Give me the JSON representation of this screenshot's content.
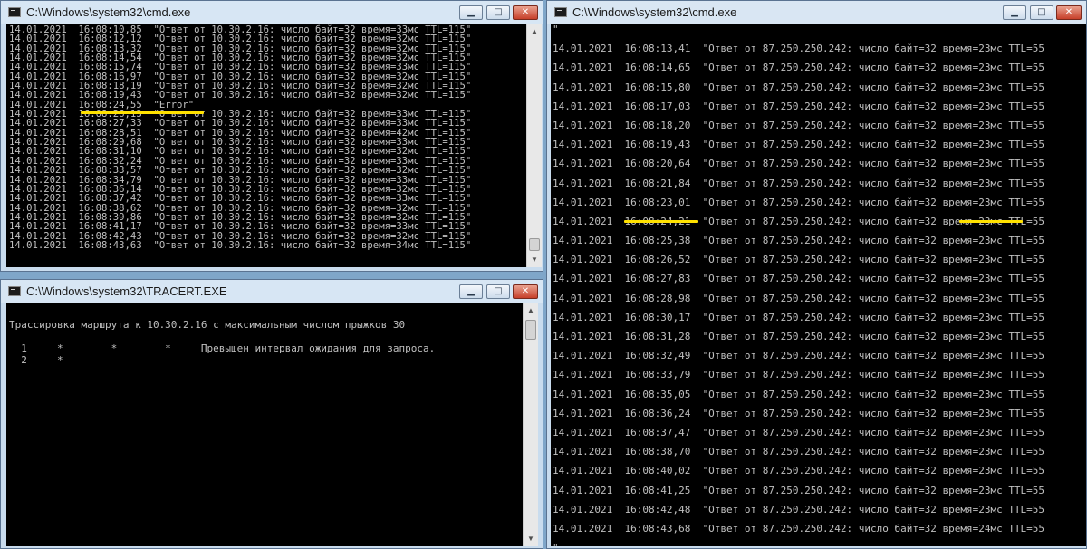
{
  "window1": {
    "title": "C:\\Windows\\system32\\cmd.exe",
    "lines": [
      "14.01.2021  16:08:10,85  \"Ответ от 10.30.2.16: число байт=32 время=33мс TTL=115\"",
      "14.01.2021  16:08:12,12  \"Ответ от 10.30.2.16: число байт=32 время=32мс TTL=115\"",
      "14.01.2021  16:08:13,32  \"Ответ от 10.30.2.16: число байт=32 время=32мс TTL=115\"",
      "14.01.2021  16:08:14,54  \"Ответ от 10.30.2.16: число байт=32 время=32мс TTL=115\"",
      "14.01.2021  16:08:15,74  \"Ответ от 10.30.2.16: число байт=32 время=33мс TTL=115\"",
      "14.01.2021  16:08:16,97  \"Ответ от 10.30.2.16: число байт=32 время=32мс TTL=115\"",
      "14.01.2021  16:08:18,19  \"Ответ от 10.30.2.16: число байт=32 время=32мс TTL=115\"",
      "14.01.2021  16:08:19,43  \"Ответ от 10.30.2.16: число байт=32 время=32мс TTL=115\"",
      "14.01.2021  16:08:24,55  \"Error\"",
      "14.01.2021  16:08:26,13  \"Ответ от 10.30.2.16: число байт=32 время=33мс TTL=115\"",
      "14.01.2021  16:08:27,33  \"Ответ от 10.30.2.16: число байт=32 время=33мс TTL=115\"",
      "14.01.2021  16:08:28,51  \"Ответ от 10.30.2.16: число байт=32 время=42мс TTL=115\"",
      "14.01.2021  16:08:29,68  \"Ответ от 10.30.2.16: число байт=32 время=33мс TTL=115\"",
      "14.01.2021  16:08:31,10  \"Ответ от 10.30.2.16: число байт=32 время=32мс TTL=115\"",
      "14.01.2021  16:08:32,24  \"Ответ от 10.30.2.16: число байт=32 время=33мс TTL=115\"",
      "14.01.2021  16:08:33,57  \"Ответ от 10.30.2.16: число байт=32 время=32мс TTL=115\"",
      "14.01.2021  16:08:34,79  \"Ответ от 10.30.2.16: число байт=32 время=33мс TTL=115\"",
      "14.01.2021  16:08:36,14  \"Ответ от 10.30.2.16: число байт=32 время=32мс TTL=115\"",
      "14.01.2021  16:08:37,42  \"Ответ от 10.30.2.16: число байт=32 время=33мс TTL=115\"",
      "14.01.2021  16:08:38,62  \"Ответ от 10.30.2.16: число байт=32 время=32мс TTL=115\"",
      "14.01.2021  16:08:39,86  \"Ответ от 10.30.2.16: число байт=32 время=32мс TTL=115\"",
      "14.01.2021  16:08:41,17  \"Ответ от 10.30.2.16: число байт=32 время=33мс TTL=115\"",
      "14.01.2021  16:08:42,43  \"Ответ от 10.30.2.16: число байт=32 время=32мс TTL=115\"",
      "14.01.2021  16:08:43,63  \"Ответ от 10.30.2.16: число байт=32 время=34мс TTL=115\""
    ]
  },
  "window2": {
    "title": "C:\\Windows\\system32\\cmd.exe",
    "lines": [
      "\"",
      "14.01.2021  16:08:13,41  \"Ответ от 87.250.250.242: число байт=32 время=23мс TTL=55",
      "14.01.2021  16:08:14,65  \"Ответ от 87.250.250.242: число байт=32 время=23мс TTL=55",
      "14.01.2021  16:08:15,80  \"Ответ от 87.250.250.242: число байт=32 время=23мс TTL=55",
      "14.01.2021  16:08:17,03  \"Ответ от 87.250.250.242: число байт=32 время=23мс TTL=55",
      "14.01.2021  16:08:18,20  \"Ответ от 87.250.250.242: число байт=32 время=23мс TTL=55",
      "14.01.2021  16:08:19,43  \"Ответ от 87.250.250.242: число байт=32 время=23мс TTL=55",
      "14.01.2021  16:08:20,64  \"Ответ от 87.250.250.242: число байт=32 время=23мс TTL=55",
      "14.01.2021  16:08:21,84  \"Ответ от 87.250.250.242: число байт=32 время=23мс TTL=55",
      "14.01.2021  16:08:23,01  \"Ответ от 87.250.250.242: число байт=32 время=23мс TTL=55",
      "14.01.2021  16:08:24,21  \"Ответ от 87.250.250.242: число байт=32 время=23мс TTL=55",
      "14.01.2021  16:08:25,38  \"Ответ от 87.250.250.242: число байт=32 время=23мс TTL=55",
      "14.01.2021  16:08:26,52  \"Ответ от 87.250.250.242: число байт=32 время=23мс TTL=55",
      "14.01.2021  16:08:27,83  \"Ответ от 87.250.250.242: число байт=32 время=23мс TTL=55",
      "14.01.2021  16:08:28,98  \"Ответ от 87.250.250.242: число байт=32 время=23мс TTL=55",
      "14.01.2021  16:08:30,17  \"Ответ от 87.250.250.242: число байт=32 время=23мс TTL=55",
      "14.01.2021  16:08:31,28  \"Ответ от 87.250.250.242: число байт=32 время=23мс TTL=55",
      "14.01.2021  16:08:32,49  \"Ответ от 87.250.250.242: число байт=32 время=23мс TTL=55",
      "14.01.2021  16:08:33,79  \"Ответ от 87.250.250.242: число байт=32 время=23мс TTL=55",
      "14.01.2021  16:08:35,05  \"Ответ от 87.250.250.242: число байт=32 время=23мс TTL=55",
      "14.01.2021  16:08:36,24  \"Ответ от 87.250.250.242: число байт=32 время=23мс TTL=55",
      "14.01.2021  16:08:37,47  \"Ответ от 87.250.250.242: число байт=32 время=23мс TTL=55",
      "14.01.2021  16:08:38,70  \"Ответ от 87.250.250.242: число байт=32 время=23мс TTL=55",
      "14.01.2021  16:08:40,02  \"Ответ от 87.250.250.242: число байт=32 время=23мс TTL=55",
      "14.01.2021  16:08:41,25  \"Ответ от 87.250.250.242: число байт=32 время=23мс TTL=55",
      "14.01.2021  16:08:42,48  \"Ответ от 87.250.250.242: число байт=32 время=23мс TTL=55",
      "14.01.2021  16:08:43,68  \"Ответ от 87.250.250.242: число байт=32 время=24мс TTL=55",
      "\""
    ]
  },
  "window3": {
    "title": "C:\\Windows\\system32\\TRACERT.EXE",
    "lines": [
      "",
      "Трассировка маршрута к 10.30.2.16 с максимальным числом прыжков 30",
      "",
      "  1     *        *        *     Превышен интервал ожидания для запроса.",
      "  2     *"
    ]
  },
  "controls": {
    "minimize": "▁",
    "maximize": "□",
    "close": "✕"
  },
  "scroll": {
    "up": "▲",
    "down": "▼"
  }
}
